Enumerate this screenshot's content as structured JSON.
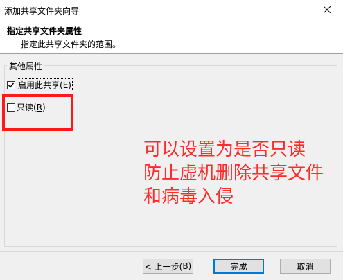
{
  "window": {
    "title": "添加共享文件夹向导"
  },
  "header": {
    "title": "指定共享文件夹属性",
    "subtitle": "指定此共享文件夹的范围。"
  },
  "group": {
    "label": "其他属性",
    "options": [
      {
        "label_pre": "启用此共享(",
        "mnemonic": "E",
        "label_post": ")",
        "checked": true
      },
      {
        "label_pre": "只读(",
        "mnemonic": "R",
        "label_post": ")",
        "checked": false
      }
    ]
  },
  "annotation": {
    "text": "可以设置为是否只读\n防止虚机删除共享文件\n和病毒入侵",
    "color": "#ff2a2a"
  },
  "buttons": {
    "back_pre": "< 上一步(",
    "back_mnemonic": "B",
    "back_post": ")",
    "finish": "完成",
    "cancel": "取消"
  },
  "colors": {
    "accent": "#0078d7",
    "highlight_box": "#ff1a1a"
  }
}
